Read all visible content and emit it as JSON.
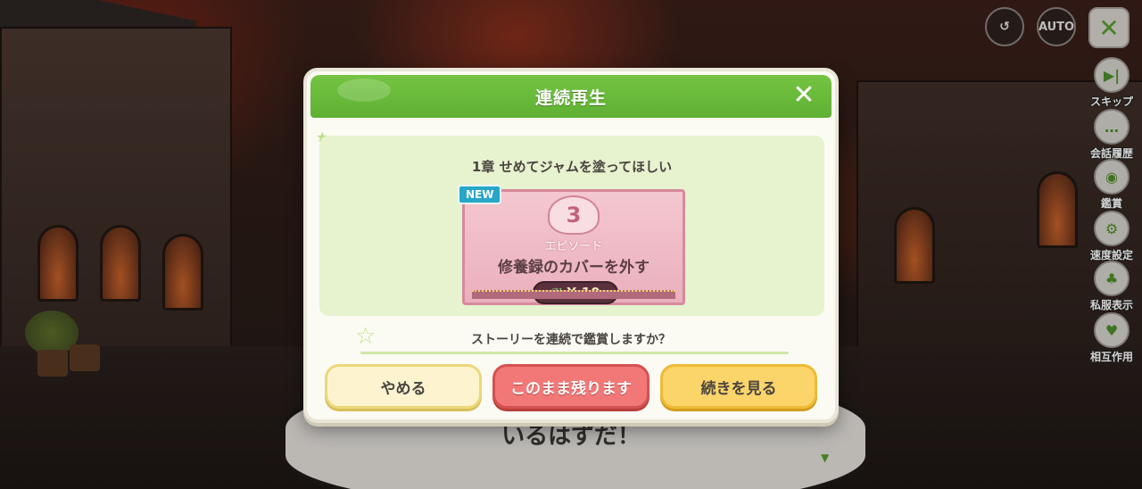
{
  "hud": {
    "auto_label": "AUTO",
    "close_glyph": "✕",
    "side_menu": [
      {
        "label": "スキップ",
        "icon": "skip-icon",
        "glyph": "▶|"
      },
      {
        "label": "会話履歴",
        "icon": "chat-history-icon",
        "glyph": "…"
      },
      {
        "label": "鑑賞",
        "icon": "camera-icon",
        "glyph": "◉"
      },
      {
        "label": "速度設定",
        "icon": "speed-settings-icon",
        "glyph": "⚙"
      },
      {
        "label": "私服表示",
        "icon": "outfit-icon",
        "glyph": "♣"
      },
      {
        "label": "相互作用",
        "icon": "interaction-icon",
        "glyph": "♥"
      }
    ]
  },
  "dialogue": {
    "text": "いるはずだ！"
  },
  "modal": {
    "title": "連続再生",
    "close_glyph": "✕",
    "chapter_title": "1章 せめてジャムを塗ってほしい",
    "episode": {
      "badge": "NEW",
      "number": "3",
      "label": "エピソード",
      "name": "修養録のカバーを外す",
      "cost": "X 10"
    },
    "question": "ストーリーを連続で鑑賞しますか？",
    "buttons": {
      "cancel": "やめる",
      "stay": "このまま残ります",
      "continue": "続きを見る"
    }
  }
}
